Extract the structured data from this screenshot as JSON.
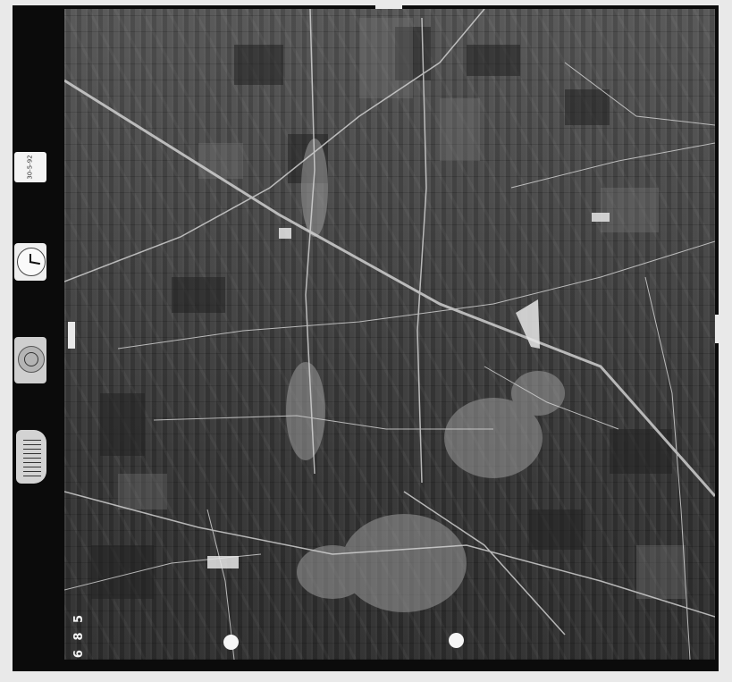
{
  "side_label": {
    "text": "30-5-92",
    "icon": "date-label"
  },
  "frame_number": {
    "text": "6 8 5"
  },
  "instruments": {
    "clock": "clock-icon",
    "level": "bubble-level-icon",
    "altimeter": "altimeter-icon"
  },
  "colors": {
    "film_border": "#0b0b0b",
    "photo_base": "#3b3b3b",
    "road_highlight": "#d8d8d8",
    "urban_area": "#9a9a9a"
  }
}
